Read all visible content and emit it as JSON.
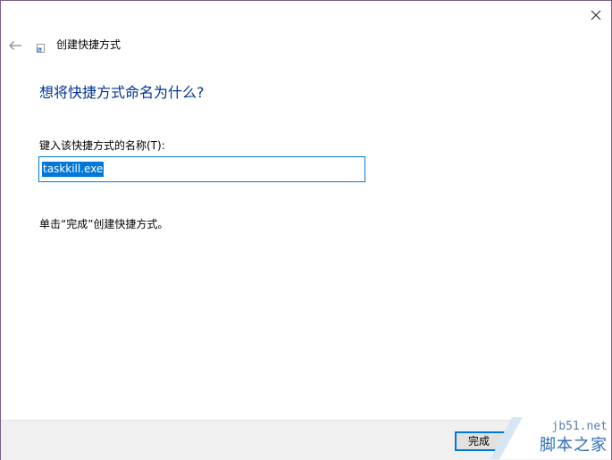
{
  "window": {
    "title": "创建快捷方式"
  },
  "titlebar": {
    "close_icon": "close-icon"
  },
  "navigation": {
    "back_icon": "back-arrow-icon"
  },
  "wizard": {
    "icon": "shortcut-icon",
    "heading": "想将快捷方式命名为什么?",
    "field_label": "键入该快捷方式的名称(T):",
    "name_value": "taskkill.exe",
    "hint": "单击“完成”创建快捷方式。"
  },
  "footer": {
    "finish_label": "完成"
  },
  "watermark": {
    "url": "jb51.net",
    "brand": "脚本之家"
  },
  "colors": {
    "heading": "#003399",
    "accent": "#0078d7",
    "frame": "#7a5e8c",
    "footer_bg": "#f0f0f0"
  }
}
